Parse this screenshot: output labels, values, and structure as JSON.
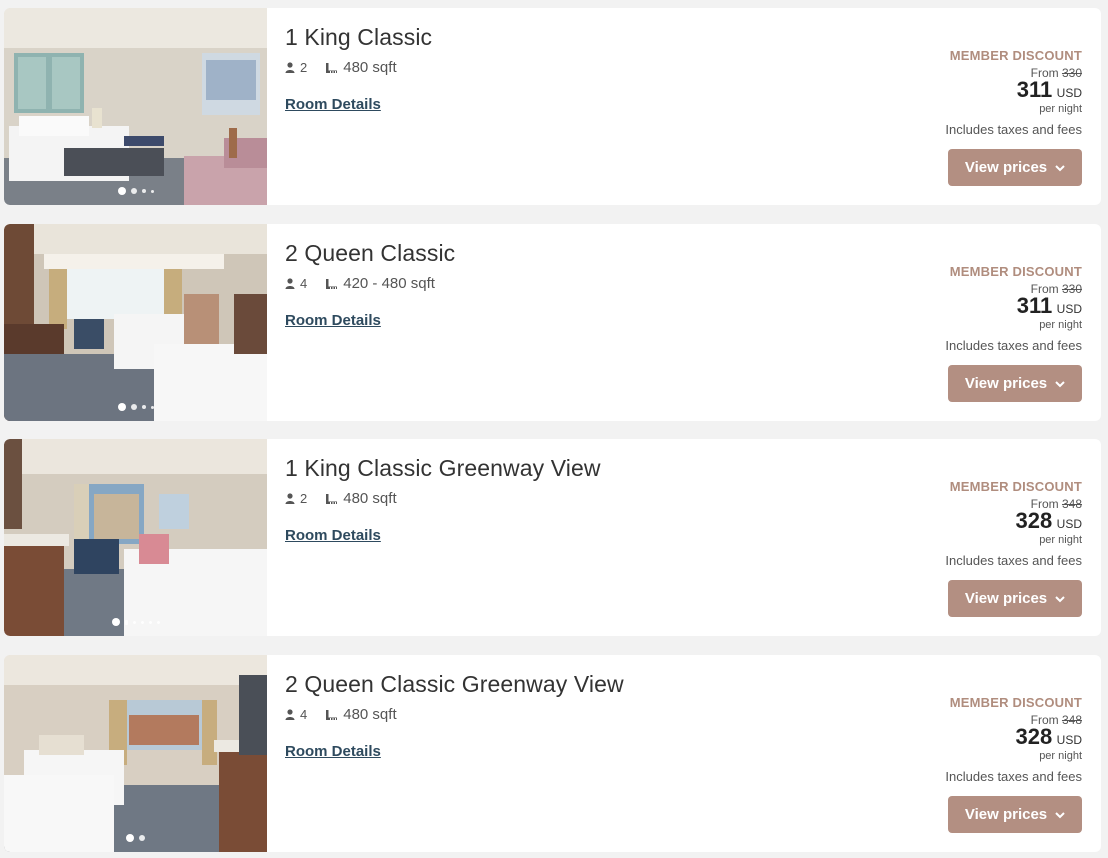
{
  "rooms": [
    {
      "title": "1 King Classic",
      "guests": "2",
      "size": "480 sqft",
      "details_label": "Room Details",
      "member_label": "MEMBER DISCOUNT",
      "from_label": "From",
      "original_price": "330",
      "price": "311",
      "currency": "USD",
      "per_night": "per night",
      "taxes": "Includes taxes and fees",
      "button_label": "View prices",
      "carousel_dots": 4
    },
    {
      "title": "2 Queen Classic",
      "guests": "4",
      "size": "420 - 480 sqft",
      "details_label": "Room Details",
      "member_label": "MEMBER DISCOUNT",
      "from_label": "From",
      "original_price": "330",
      "price": "311",
      "currency": "USD",
      "per_night": "per night",
      "taxes": "Includes taxes and fees",
      "button_label": "View prices",
      "carousel_dots": 4
    },
    {
      "title": "1 King Classic Greenway View",
      "guests": "2",
      "size": "480 sqft",
      "details_label": "Room Details",
      "member_label": "MEMBER DISCOUNT",
      "from_label": "From",
      "original_price": "348",
      "price": "328",
      "currency": "USD",
      "per_night": "per night",
      "taxes": "Includes taxes and fees",
      "button_label": "View prices",
      "carousel_dots": 6
    },
    {
      "title": "2 Queen Classic Greenway View",
      "guests": "4",
      "size": "480 sqft",
      "details_label": "Room Details",
      "member_label": "MEMBER DISCOUNT",
      "from_label": "From",
      "original_price": "348",
      "price": "328",
      "currency": "USD",
      "per_night": "per night",
      "taxes": "Includes taxes and fees",
      "button_label": "View prices",
      "carousel_dots": 2
    }
  ],
  "icons": {
    "guests": "person-icon",
    "size": "ruler-icon",
    "button": "chevron-down-icon"
  },
  "colors": {
    "accent": "#b38f82",
    "member_text": "#b08d7e",
    "link": "#2e4a5e",
    "background": "#f2f2f2"
  }
}
